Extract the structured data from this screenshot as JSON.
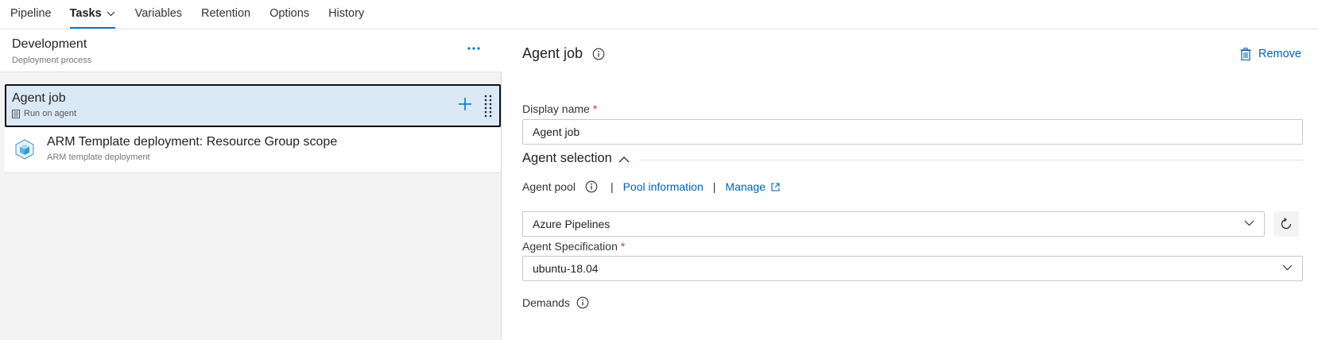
{
  "tabs": [
    {
      "label": "Pipeline"
    },
    {
      "label": "Tasks"
    },
    {
      "label": "Variables"
    },
    {
      "label": "Retention"
    },
    {
      "label": "Options"
    },
    {
      "label": "History"
    }
  ],
  "stage": {
    "title": "Development",
    "subtitle": "Deployment process",
    "more_label": "..."
  },
  "job": {
    "title": "Agent job",
    "subtitle": "Run on agent"
  },
  "task": {
    "title": "ARM Template deployment: Resource Group scope",
    "subtitle": "ARM template deployment"
  },
  "detail": {
    "title": "Agent job",
    "remove_label": "Remove",
    "display_name_label": "Display name",
    "display_name_value": "Agent job",
    "required_mark": "*",
    "section_title": "Agent selection",
    "agent_pool_label": "Agent pool",
    "separator": "|",
    "pool_information_link": "Pool information",
    "manage_link": "Manage",
    "agent_pool_value": "Azure Pipelines",
    "agent_spec_label": "Agent Specification",
    "agent_spec_value": "ubuntu-18.04",
    "demands_label": "Demands"
  },
  "colors": {
    "accent": "#0078d4",
    "link": "#0063b1",
    "selected_bg": "#dbe9f7",
    "required": "#c4314b"
  }
}
